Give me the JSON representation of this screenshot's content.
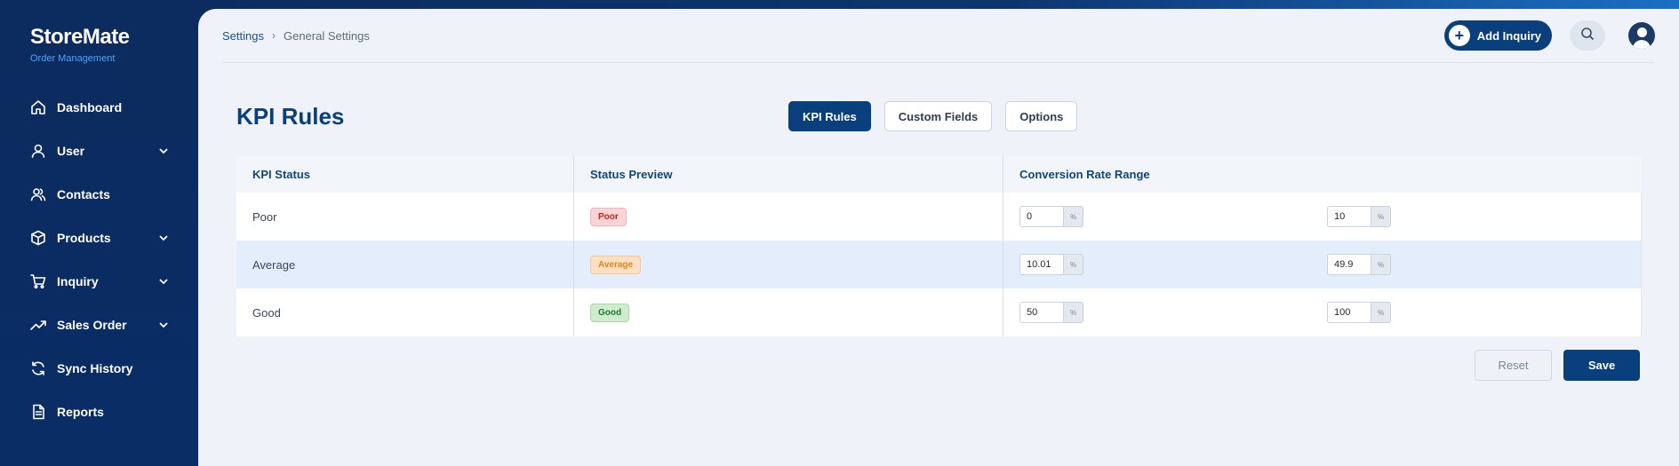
{
  "brand": {
    "name": "StoreMate",
    "subtitle": "Order Management"
  },
  "sidebar": {
    "items": [
      {
        "label": "Dashboard",
        "icon": "home-icon",
        "expandable": false
      },
      {
        "label": "User",
        "icon": "user-icon",
        "expandable": true
      },
      {
        "label": "Contacts",
        "icon": "contacts-icon",
        "expandable": false
      },
      {
        "label": "Products",
        "icon": "box-icon",
        "expandable": true
      },
      {
        "label": "Inquiry",
        "icon": "cart-icon",
        "expandable": true
      },
      {
        "label": "Sales Order",
        "icon": "trend-icon",
        "expandable": true
      },
      {
        "label": "Sync History",
        "icon": "sync-icon",
        "expandable": false
      },
      {
        "label": "Reports",
        "icon": "document-icon",
        "expandable": false
      }
    ]
  },
  "header": {
    "breadcrumb": [
      "Settings",
      "General Settings"
    ],
    "add_label": "Add Inquiry"
  },
  "page": {
    "title": "KPI Rules"
  },
  "tabs": [
    {
      "label": "KPI Rules",
      "active": true
    },
    {
      "label": "Custom Fields",
      "active": false
    },
    {
      "label": "Options",
      "active": false
    }
  ],
  "table": {
    "headers": [
      "KPI Status",
      "Status Preview",
      "Conversion Rate Range"
    ],
    "rows": [
      {
        "status": "Poor",
        "badge": "Poor",
        "min": "0",
        "max": "10",
        "unit": "%"
      },
      {
        "status": "Average",
        "badge": "Average",
        "min": "10.01",
        "max": "49.9",
        "unit": "%"
      },
      {
        "status": "Good",
        "badge": "Good",
        "min": "50",
        "max": "100",
        "unit": "%"
      }
    ]
  },
  "actions": {
    "reset_label": "Reset",
    "save_label": "Save"
  },
  "colors": {
    "primary": "#0a3f7d",
    "sidebar": "#0c2b5e",
    "poor": "#c0241d",
    "average": "#e0851c",
    "good": "#1f7a2c"
  }
}
